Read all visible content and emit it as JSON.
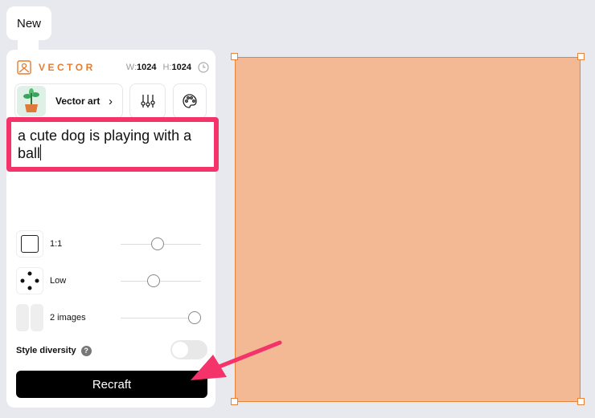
{
  "tab": {
    "label": "New"
  },
  "header": {
    "brand": "VECTOR",
    "w_label": "W:",
    "w_value": "1024",
    "h_label": "H:",
    "h_value": "1024"
  },
  "style": {
    "name": "Vector art",
    "icons": [
      "sliders-icon",
      "palette-icon"
    ]
  },
  "prompt": {
    "value": "a cute dog is playing with a ball"
  },
  "settings": [
    {
      "label": "1:1",
      "icon": "aspect-ratio-icon",
      "slider": 0.46
    },
    {
      "label": "Low",
      "icon": "dots-icon",
      "slider": 0.41
    },
    {
      "label": "2 images",
      "icon": "image-count-icon",
      "slider": 0.92
    }
  ],
  "style_diversity": {
    "label": "Style diversity",
    "enabled": false
  },
  "action": {
    "label": "Recraft"
  },
  "colors": {
    "accent": "#e87b2c",
    "highlight": "#f5336b",
    "canvas": "#f2b994"
  }
}
